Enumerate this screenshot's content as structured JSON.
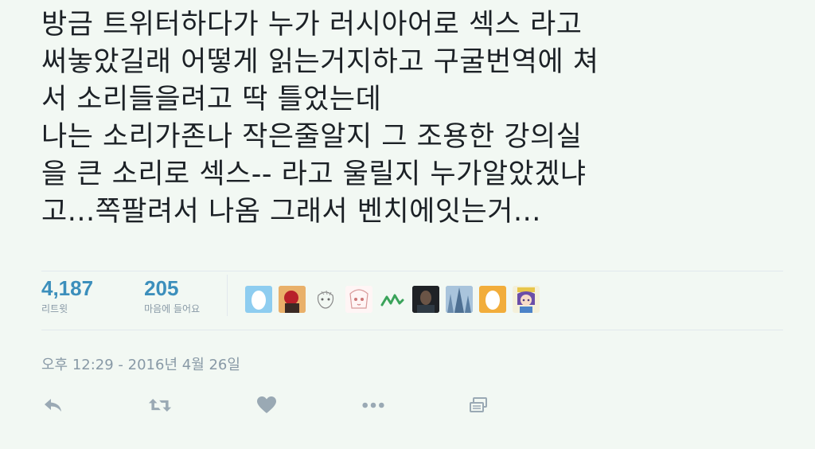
{
  "tweet": {
    "lines": [
      "방금 트위터하다가 누가 러시아어로 섹스 라고",
      "써놓았길래 어떻게 읽는거지하고 구굴번역에 쳐",
      "서 소리들을려고 딱 틀었는데",
      "나는 소리가존나 작은줄알지 그 조용한 강의실",
      "을 큰 소리로 섹스-- 라고 울릴지 누가알았겠냐",
      "고...쪽팔려서 나옴 그래서 벤치에잇는거..."
    ]
  },
  "stats": {
    "retweets": {
      "count": "4,187",
      "label": "리트윗"
    },
    "likes": {
      "count": "205",
      "label": "마음에 들어요"
    }
  },
  "liked_by_avatars": [
    "egg-avatar-blue",
    "red-hat-avatar",
    "sketch-avatar",
    "anime-sketch-avatar",
    "green-logo-avatar",
    "dark-photo-avatar",
    "blue-tower-avatar",
    "egg-avatar-orange",
    "anime-girl-avatar"
  ],
  "timestamp": "오후 12:29 - 2016년 4월 26일",
  "actions": [
    "reply-icon",
    "retweet-icon",
    "heart-icon",
    "more-icon",
    "share-icon"
  ],
  "colors": {
    "background": "#f2f8f3",
    "stat_count": "#3c8fbc",
    "muted": "#8899a6",
    "divider": "#e1e8ed"
  }
}
